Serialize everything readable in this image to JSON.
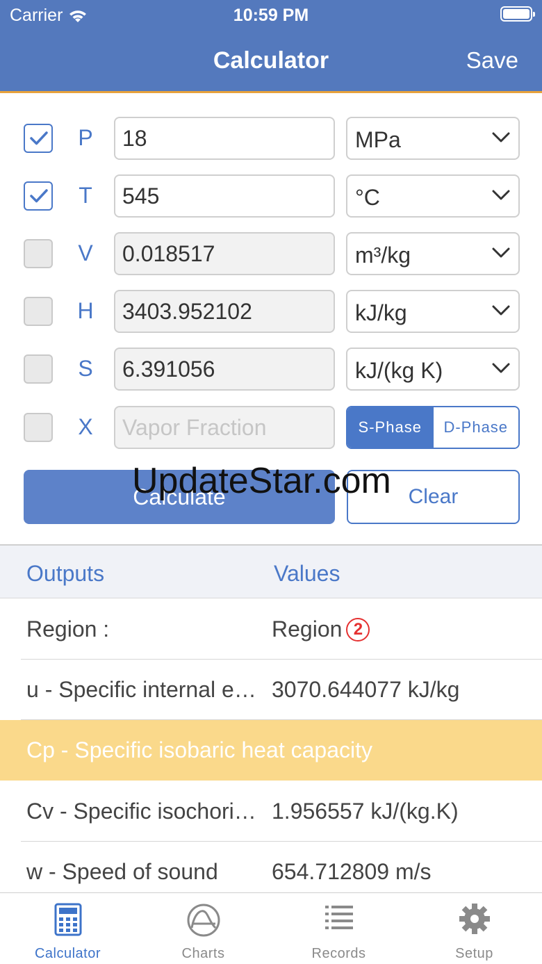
{
  "status_bar": {
    "carrier": "Carrier",
    "time": "10:59 PM"
  },
  "nav": {
    "title": "Calculator",
    "save_label": "Save"
  },
  "inputs": [
    {
      "label": "P",
      "checked": true,
      "value": "18",
      "unit": "MPa"
    },
    {
      "label": "T",
      "checked": true,
      "value": "545",
      "unit": "°C"
    },
    {
      "label": "V",
      "checked": false,
      "value": "0.018517",
      "unit": "m³/kg"
    },
    {
      "label": "H",
      "checked": false,
      "value": "3403.952102",
      "unit": "kJ/kg"
    },
    {
      "label": "S",
      "checked": false,
      "value": "6.391056",
      "unit": "kJ/(kg K)"
    },
    {
      "label": "X",
      "checked": false,
      "value": "",
      "placeholder": "Vapor Fraction"
    }
  ],
  "phase": {
    "s_label": "S-Phase",
    "d_label": "D-Phase",
    "selected": "S-Phase"
  },
  "actions": {
    "calculate_label": "Calculate",
    "clear_label": "Clear"
  },
  "watermark": "UpdateStar.com",
  "outputs": {
    "header_outputs": "Outputs",
    "header_values": "Values",
    "rows": [
      {
        "name": "Region :",
        "value": "Region",
        "badge": "2"
      },
      {
        "name": "u - Specific internal energy",
        "value": "3070.644077 kJ/kg"
      },
      {
        "name": "Cp - Specific isobaric heat capacity",
        "value": ""
      },
      {
        "name": "Cv - Specific isochoric heat capacity",
        "value": "1.956557 kJ/(kg.K)"
      },
      {
        "name": "w - Speed of sound",
        "value": "654.712809 m/s"
      }
    ]
  },
  "tabs": [
    {
      "label": "Calculator",
      "icon": "calculator-icon",
      "active": true
    },
    {
      "label": "Charts",
      "icon": "chart-icon",
      "active": false
    },
    {
      "label": "Records",
      "icon": "list-icon",
      "active": false
    },
    {
      "label": "Setup",
      "icon": "gear-icon",
      "active": false
    }
  ],
  "colors": {
    "primary": "#5479bd",
    "accent_border": "#e8a23c",
    "highlight_row": "#fad98b",
    "badge_red": "#e53030"
  }
}
